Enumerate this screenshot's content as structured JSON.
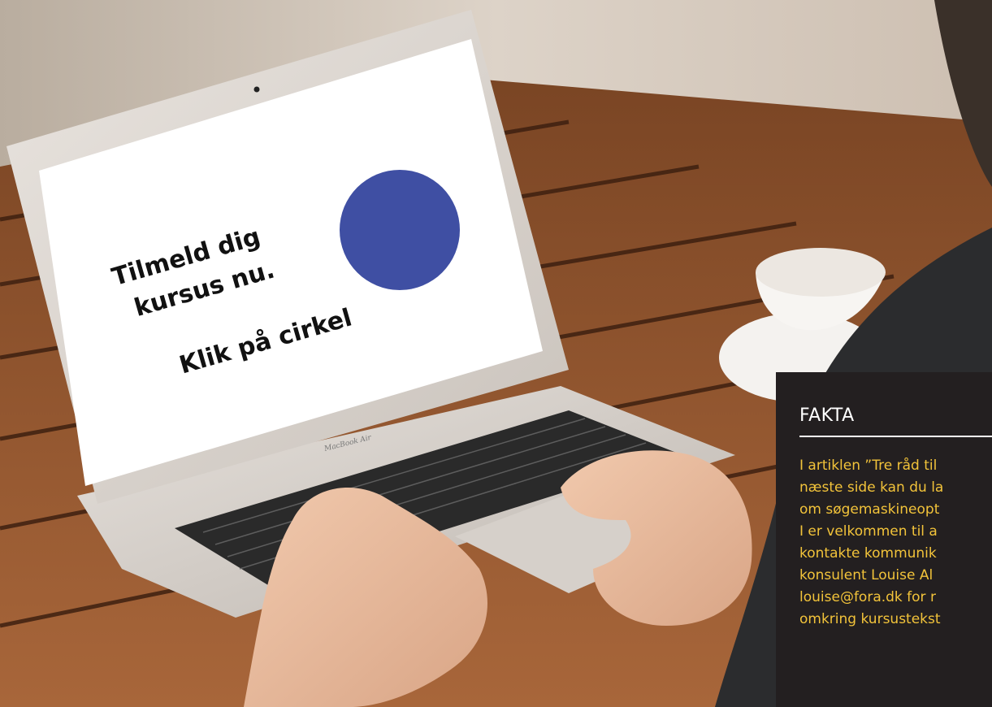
{
  "screen": {
    "headline_line1": "Tilmeld dig",
    "headline_line2": "kursus nu.",
    "cta": "Klik på cirkel",
    "brand_label": "MacBook Air"
  },
  "fakta": {
    "title": "FAKTA",
    "lines": [
      "I artiklen ”Tre råd til",
      "næste side kan du la",
      "om søgemaskineopt",
      "I er velkommen til a",
      "kontakte kommunik",
      "konsulent Louise Al",
      "louise@fora.dk for r",
      "omkring kursustekst"
    ]
  },
  "colors": {
    "circle": "#3f4fa3",
    "fakta_background": "#231f20",
    "fakta_text": "#f2c33a",
    "wall": "#d9cfc4",
    "table": "#9a5a30"
  }
}
